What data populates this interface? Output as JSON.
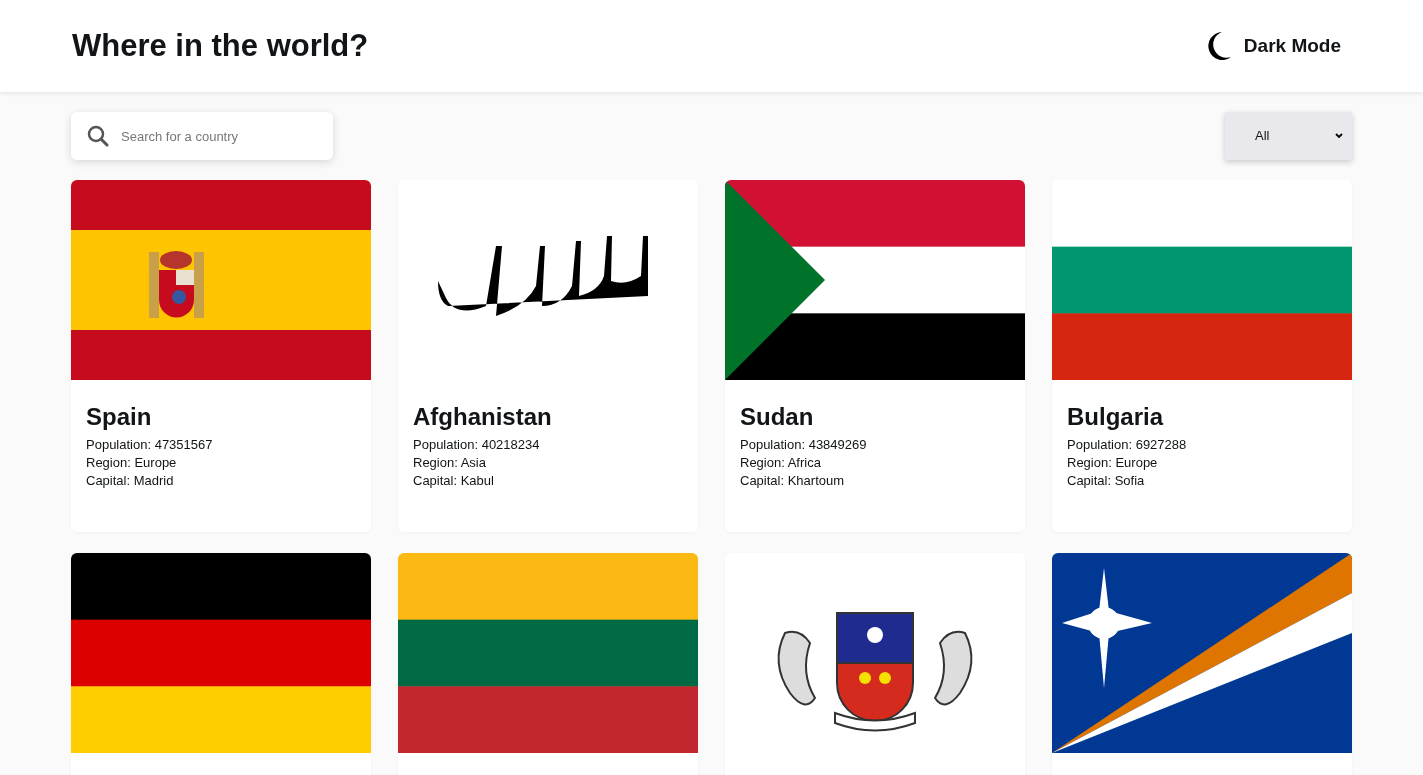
{
  "header": {
    "title": "Where in the world?",
    "theme_toggle": "Dark Mode"
  },
  "search": {
    "placeholder": "Search for a country"
  },
  "region_filter": {
    "value": "All"
  },
  "countries": [
    {
      "kind": "spain",
      "name": "Spain",
      "population": "Population: 47351567",
      "region": "Region: Europe",
      "capital": "Capital: Madrid"
    },
    {
      "kind": "afghanistan",
      "name": "Afghanistan",
      "population": "Population: 40218234",
      "region": "Region: Asia",
      "capital": "Capital: Kabul"
    },
    {
      "kind": "sudan",
      "name": "Sudan",
      "population": "Population: 43849269",
      "region": "Region: Africa",
      "capital": "Capital: Khartoum"
    },
    {
      "kind": "bulgaria",
      "name": "Bulgaria",
      "population": "Population: 6927288",
      "region": "Region: Europe",
      "capital": "Capital: Sofia"
    },
    {
      "kind": "germany"
    },
    {
      "kind": "lithuania"
    },
    {
      "kind": "mayotte"
    },
    {
      "kind": "marshall"
    }
  ]
}
